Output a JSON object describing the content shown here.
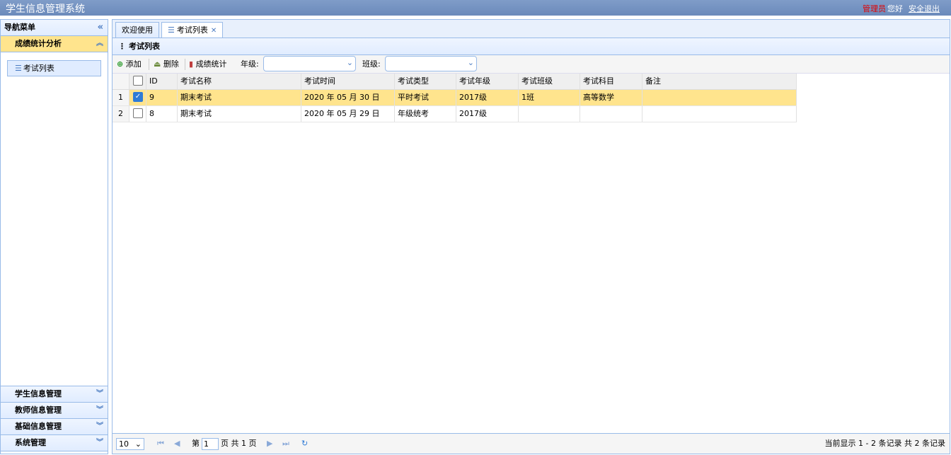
{
  "app": {
    "title": "学生信息管理系统"
  },
  "header": {
    "role": "管理员",
    "greeting": "您好",
    "logout": "安全退出"
  },
  "sidebar": {
    "title": "导航菜单",
    "active_section": {
      "label": "成绩统计分析",
      "items": [
        {
          "label": "考试列表"
        }
      ]
    },
    "sections": [
      {
        "label": "学生信息管理"
      },
      {
        "label": "教师信息管理"
      },
      {
        "label": "基础信息管理"
      },
      {
        "label": "系统管理"
      }
    ]
  },
  "tabs": [
    {
      "label": "欢迎使用"
    },
    {
      "label": "考试列表"
    }
  ],
  "panel": {
    "title": "考试列表"
  },
  "toolbar": {
    "add": "添加",
    "delete": "删除",
    "stats": "成绩统计",
    "grade_label": "年级:",
    "grade_value": "",
    "class_label": "班级:",
    "class_value": ""
  },
  "table": {
    "columns": [
      "ID",
      "考试名称",
      "考试时间",
      "考试类型",
      "考试年级",
      "考试班级",
      "考试科目",
      "备注"
    ],
    "rows": [
      {
        "num": "1",
        "checked": true,
        "cells": [
          "9",
          "期末考试",
          "2020 年 05 月 30 日",
          "平时考试",
          "2017级",
          "1班",
          "高等数学",
          ""
        ]
      },
      {
        "num": "2",
        "checked": false,
        "cells": [
          "8",
          "期末考试",
          "2020 年 05 月 29 日",
          "年级统考",
          "2017级",
          "",
          "",
          ""
        ]
      }
    ]
  },
  "pager": {
    "page_size": "10",
    "page_prefix": "第",
    "page_value": "1",
    "page_suffix": "页 共 1 页",
    "summary": "当前显示 1 - 2 条记录 共 2 条记录"
  },
  "colors": {
    "accent": "#99bbe8",
    "selected_row": "#ffe48d",
    "header_bar": "#7f9cc8",
    "admin_text": "#e00000"
  }
}
